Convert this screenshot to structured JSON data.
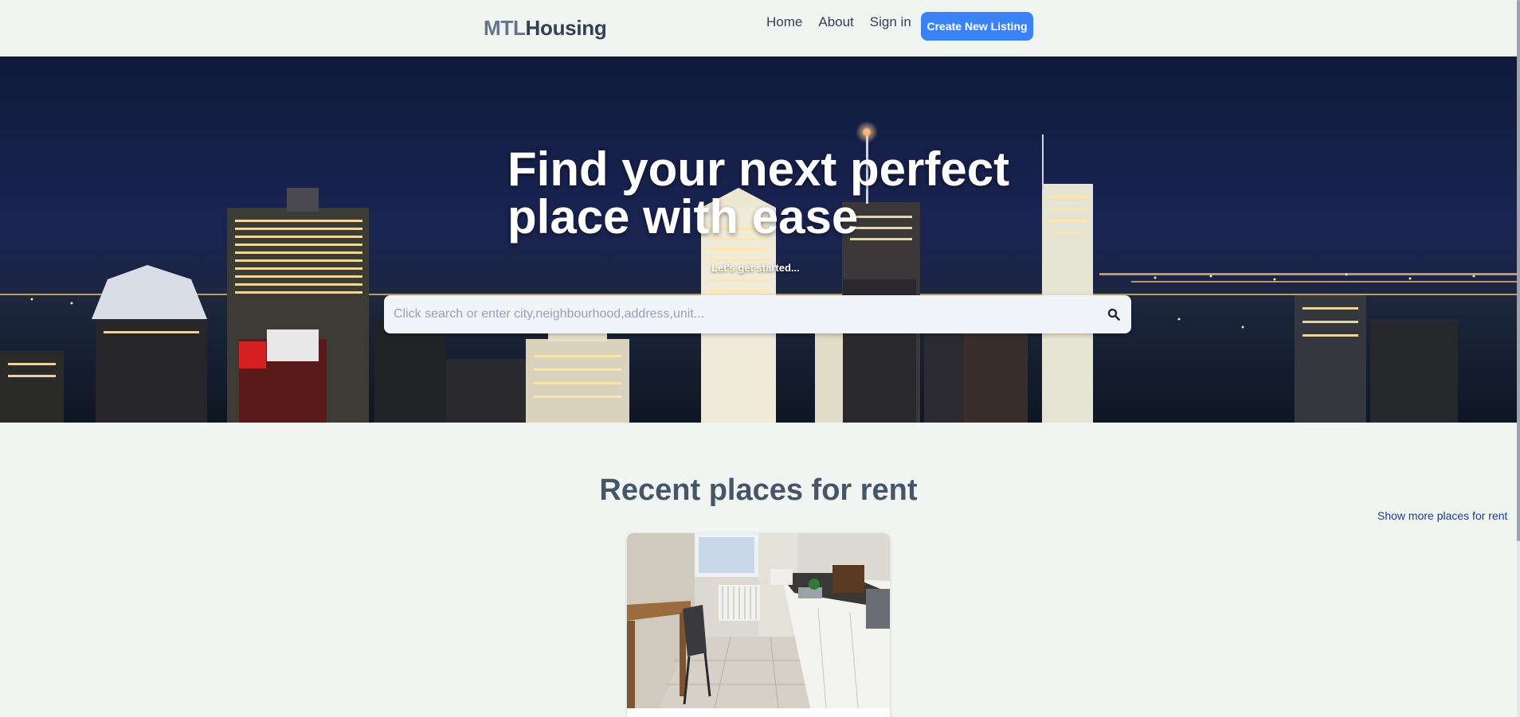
{
  "header": {
    "logo_part1": "MTL",
    "logo_part2": "Housing",
    "nav": [
      "Home",
      "About",
      "Sign in"
    ],
    "cta_label": "Create New Listing"
  },
  "hero": {
    "title": "Find your next perfect place with ease",
    "subtitle": "Let's get started...",
    "search_placeholder": "Click search or enter city,neighbourhood,address,unit...",
    "search_value": ""
  },
  "recent": {
    "title": "Recent places for rent",
    "show_more_label": "Show more places for rent"
  },
  "colors": {
    "accent": "#3b82f6",
    "page_background": "#f1f5f2",
    "heading": "#475569",
    "link": "#1e3a8a"
  },
  "icons": [
    "search-icon"
  ]
}
